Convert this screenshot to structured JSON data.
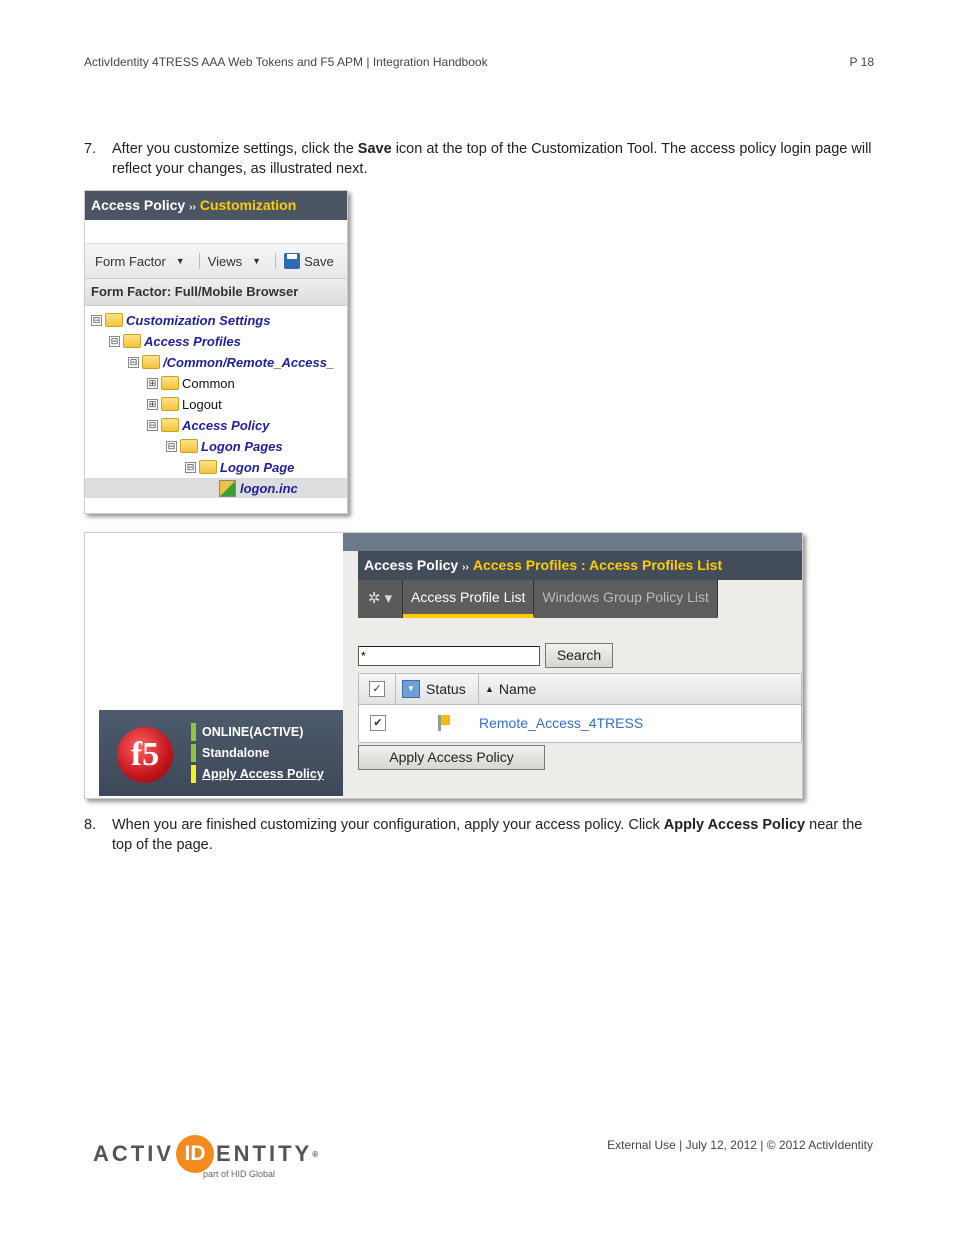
{
  "header": {
    "title": "ActivIdentity 4TRESS AAA Web Tokens and F5 APM | Integration Handbook",
    "page": "P 18"
  },
  "steps": [
    {
      "number": "7.",
      "text_before": "After you customize settings, click the ",
      "bold": "Save",
      "text_after": " icon at the top of the Customization Tool. The access policy login page will reflect your changes, as illustrated next."
    },
    {
      "number": "8.",
      "text_before": "When you are finished customizing your configuration, apply your access policy. Click ",
      "bold": "Apply Access Policy",
      "text_after": " near the top of the page."
    }
  ],
  "customization_tool": {
    "breadcrumb_root": "Access Policy",
    "breadcrumb_sep": "››",
    "breadcrumb_current": "Customization",
    "toolbar": {
      "form_factor": "Form Factor",
      "views": "Views",
      "save": "Save"
    },
    "form_factor_label": "Form Factor: Full/Mobile Browser",
    "tree": [
      {
        "label": "Customization Settings",
        "toggle": "⊟",
        "style": "link"
      },
      {
        "label": "Access Profiles",
        "toggle": "⊟",
        "style": "link"
      },
      {
        "label": "/Common/Remote_Access_",
        "toggle": "⊟",
        "style": "link"
      },
      {
        "label": "Common",
        "toggle": "⊞",
        "style": "plain"
      },
      {
        "label": "Logout",
        "toggle": "⊞",
        "style": "plain"
      },
      {
        "label": "Access Policy",
        "toggle": "⊟",
        "style": "link"
      },
      {
        "label": "Logon Pages",
        "toggle": "⊟",
        "style": "link"
      },
      {
        "label": "Logon Page",
        "toggle": "⊟",
        "style": "link"
      },
      {
        "label": "logon.inc",
        "toggle": "",
        "style": "link",
        "selected": true
      }
    ]
  },
  "access_profiles": {
    "breadcrumb_root": "Access Policy",
    "breadcrumb_sep": "››",
    "breadcrumb_current": "Access Profiles : Access Profiles List",
    "gear_menu": "✲ ▾",
    "tabs": [
      {
        "label": "Access Profile List",
        "active": true
      },
      {
        "label": "Windows Group Policy List",
        "active": false
      }
    ],
    "search_value": "*",
    "search_button": "Search",
    "columns": [
      "Status",
      "Name"
    ],
    "sort_indicator": "▲",
    "rows": [
      {
        "checked": true,
        "status": "flag-yellow",
        "name": "Remote_Access_4TRESS"
      }
    ],
    "apply_button": "Apply Access Policy",
    "sidebar": {
      "logo": "f5",
      "status_items": [
        {
          "label": "ONLINE(ACTIVE)",
          "color": "#8dc63f"
        },
        {
          "label": "Standalone",
          "color": "#8dc63f"
        },
        {
          "label": "Apply Access Policy",
          "color": "#f7f01e",
          "link": true
        }
      ]
    }
  },
  "footer": {
    "logo_left": "ACTIV",
    "logo_id": "ID",
    "logo_right": "ENTITY",
    "logo_reg": "®",
    "logo_sub": "part of HID Global",
    "text": "External Use | July 12, 2012 | © 2012 ActivIdentity"
  }
}
